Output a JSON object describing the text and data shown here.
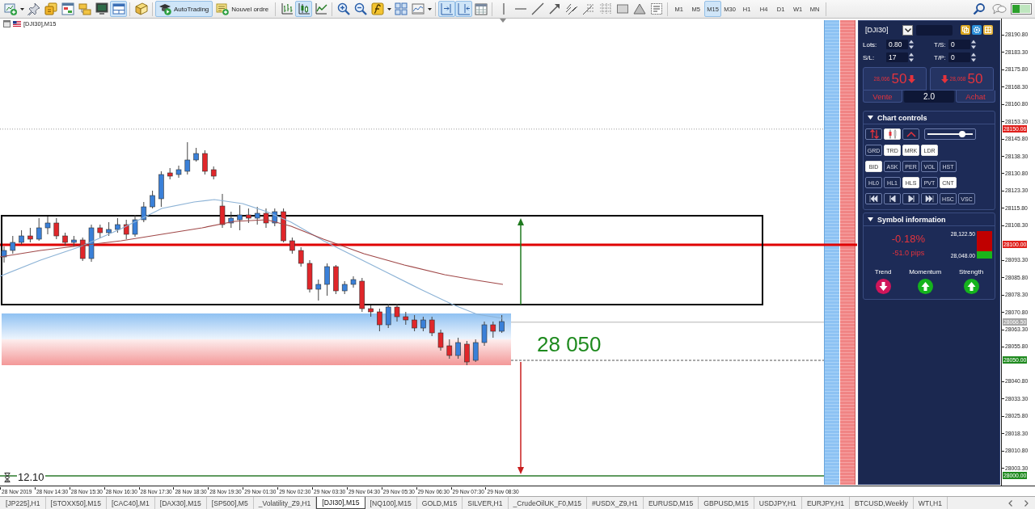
{
  "toolbar": {
    "groups": [
      [
        {
          "kind": "icon",
          "on": false
        },
        {
          "kind": "caret"
        },
        {
          "kind": "icon",
          "on": false
        },
        {
          "kind": "icon",
          "on": false
        },
        {
          "kind": "icon",
          "on": false
        },
        {
          "kind": "icon",
          "on": false
        },
        {
          "kind": "icon",
          "on": false
        },
        {
          "kind": "icon",
          "on": true
        }
      ],
      [
        {
          "kind": "icon",
          "on": false
        }
      ],
      [
        {
          "kind": "button",
          "label": "AutoTrading",
          "on": true
        },
        {
          "kind": "button",
          "label": "Nouvel ordre",
          "on": false
        }
      ],
      [
        {
          "kind": "icon",
          "on": false
        },
        {
          "kind": "icon",
          "on": true
        },
        {
          "kind": "icon",
          "on": false
        }
      ],
      [
        {
          "kind": "icon",
          "on": false
        },
        {
          "kind": "icon",
          "on": false
        },
        {
          "kind": "icon",
          "on": false
        },
        {
          "kind": "caret"
        },
        {
          "kind": "icon",
          "on": false
        },
        {
          "kind": "icon",
          "on": false
        },
        {
          "kind": "caret"
        }
      ],
      [
        {
          "kind": "icon",
          "on": true
        },
        {
          "kind": "icon",
          "on": true
        },
        {
          "kind": "icon",
          "on": false
        }
      ],
      [
        {
          "kind": "icon",
          "on": false
        },
        {
          "kind": "icon",
          "on": false
        },
        {
          "kind": "icon",
          "on": false
        },
        {
          "kind": "icon",
          "on": false
        },
        {
          "kind": "icon",
          "on": false
        },
        {
          "kind": "icon",
          "on": false
        },
        {
          "kind": "icon",
          "on": false
        },
        {
          "kind": "icon",
          "on": false
        },
        {
          "kind": "icon",
          "on": false
        },
        {
          "kind": "icon",
          "on": false
        }
      ],
      [
        {
          "kind": "timeframe",
          "label": "M1",
          "selected": false
        },
        {
          "kind": "timeframe",
          "label": "M5",
          "selected": false
        },
        {
          "kind": "timeframe",
          "label": "M15",
          "selected": true
        },
        {
          "kind": "timeframe",
          "label": "M30",
          "selected": false
        },
        {
          "kind": "timeframe",
          "label": "H1",
          "selected": false
        },
        {
          "kind": "timeframe",
          "label": "H4",
          "selected": false
        },
        {
          "kind": "timeframe",
          "label": "D1",
          "selected": false
        },
        {
          "kind": "timeframe",
          "label": "W1",
          "selected": false
        },
        {
          "kind": "timeframe",
          "label": "MN",
          "selected": false
        }
      ]
    ]
  },
  "chart": {
    "title": "[DJI30],M15",
    "target_label": "28 050",
    "timer": "12.10",
    "price_axis": {
      "ticks": [
        "28190.80",
        "28183.30",
        "28175.80",
        "28168.30",
        "28160.80",
        "28153.30",
        "28145.80",
        "28138.30",
        "28130.80",
        "28123.30",
        "28115.80",
        "28108.30",
        "28093.30",
        "28085.80",
        "28078.30",
        "28070.80",
        "28063.30",
        "28055.80",
        "28040.80",
        "28033.30",
        "28025.80",
        "28018.30",
        "28010.80",
        "28003.30"
      ],
      "markers": [
        {
          "text": "28150.06",
          "kind": "dotted",
          "color": "#e0201c"
        },
        {
          "text": "28100.00",
          "kind": "thick",
          "color": "#e0201c"
        },
        {
          "text": "28066.50",
          "kind": "bid",
          "color": "#a6a6a6"
        },
        {
          "text": "28050.00",
          "kind": "dashed",
          "color": "#1f8a1f"
        },
        {
          "text": "28000.00",
          "kind": "solid",
          "color": "#1f8a1f"
        }
      ]
    },
    "time_axis": {
      "labels": [
        "28 Nov 2019",
        "28 Nov 14:30",
        "28 Nov 15:30",
        "28 Nov 16:30",
        "28 Nov 17:30",
        "28 Nov 18:30",
        "28 Nov 19:30",
        "29 Nov 01:30",
        "29 Nov 02:30",
        "29 Nov 03:30",
        "29 Nov 04:30",
        "29 Nov 05:30",
        "29 Nov 06:30",
        "29 Nov 07:30",
        "29 Nov 08:30"
      ]
    }
  },
  "panel": {
    "symbol": "[DJI30]",
    "fields": [
      {
        "label": "Lots:",
        "value": "0.80"
      },
      {
        "label": "T/S:",
        "value": "0"
      },
      {
        "label": "S/L:",
        "value": "17"
      },
      {
        "label": "T/P:",
        "value": "0"
      }
    ],
    "sell": {
      "price": "28,066",
      "pips": "50",
      "label": "Vente",
      "up": false
    },
    "buy": {
      "price": "28,068",
      "pips": "50",
      "label": "Achat",
      "up": false
    },
    "spread": "2.0",
    "chart_controls": {
      "title": "Chart controls",
      "expanded": true,
      "rows": [
        [
          {
            "kind": "icon",
            "on": false
          },
          {
            "kind": "icon",
            "on": true
          },
          {
            "kind": "icon",
            "on": false
          },
          {
            "kind": "slider",
            "level": 0.8
          }
        ],
        [
          {
            "kind": "label",
            "label": "GRD",
            "on": false
          },
          {
            "kind": "label",
            "label": "TRD",
            "on": true
          },
          {
            "kind": "label",
            "label": "MRK",
            "on": true
          },
          {
            "kind": "label",
            "label": "LDR",
            "on": true
          }
        ],
        [
          {
            "kind": "label",
            "label": "BID",
            "on": true
          },
          {
            "kind": "label",
            "label": "ASK",
            "on": false
          },
          {
            "kind": "label",
            "label": "PER",
            "on": false
          },
          {
            "kind": "label",
            "label": "VOL",
            "on": false
          },
          {
            "kind": "label",
            "label": "HST",
            "on": false
          }
        ],
        [
          {
            "kind": "label",
            "label": "HL0",
            "on": false
          },
          {
            "kind": "label",
            "label": "HL1",
            "on": false
          },
          {
            "kind": "label",
            "label": "HLS",
            "on": true
          },
          {
            "kind": "label",
            "label": "PVT",
            "on": false
          },
          {
            "kind": "label",
            "label": "CNT",
            "on": true
          }
        ],
        [
          {
            "kind": "icon",
            "on": false
          },
          {
            "kind": "icon",
            "on": false
          },
          {
            "kind": "icon",
            "on": false
          },
          {
            "kind": "icon",
            "on": false
          },
          {
            "kind": "label",
            "label": "HSC",
            "on": false
          },
          {
            "kind": "label",
            "label": "VSC",
            "on": false
          }
        ]
      ]
    },
    "symbol_info": {
      "title": "Symbol information",
      "expanded": true,
      "change": "-0.18%",
      "pips": "-51.0 pips",
      "high": "28,122.50",
      "low": "28,048.00",
      "range": {
        "level": 0.26
      },
      "signals": [
        {
          "label": "Trend",
          "up": false
        },
        {
          "label": "Momentum",
          "up": true
        },
        {
          "label": "Strength",
          "up": true
        }
      ]
    }
  },
  "tabs": [
    {
      "label": "[JP225],H1",
      "selected": false
    },
    {
      "label": "[STOXX50],M15",
      "selected": false
    },
    {
      "label": "[CAC40],M1",
      "selected": false
    },
    {
      "label": "[DAX30],M15",
      "selected": false
    },
    {
      "label": "[SP500],M5",
      "selected": false
    },
    {
      "label": "_Volatility_Z9,H1",
      "selected": false
    },
    {
      "label": "[DJI30],M15",
      "selected": true
    },
    {
      "label": "[NQ100],M15",
      "selected": false
    },
    {
      "label": "GOLD,M15",
      "selected": false
    },
    {
      "label": "SILVER,H1",
      "selected": false
    },
    {
      "label": "_CrudeOilUK_F0,M15",
      "selected": false
    },
    {
      "label": "#USDX_Z9,H1",
      "selected": false
    },
    {
      "label": "EURUSD,M15",
      "selected": false
    },
    {
      "label": "GBPUSD,M15",
      "selected": false
    },
    {
      "label": "USDJPY,H1",
      "selected": false
    },
    {
      "label": "EURJPY,H1",
      "selected": false
    },
    {
      "label": "BTCUSD,Weekly",
      "selected": false
    },
    {
      "label": "WTI,H1",
      "selected": false
    }
  ]
}
